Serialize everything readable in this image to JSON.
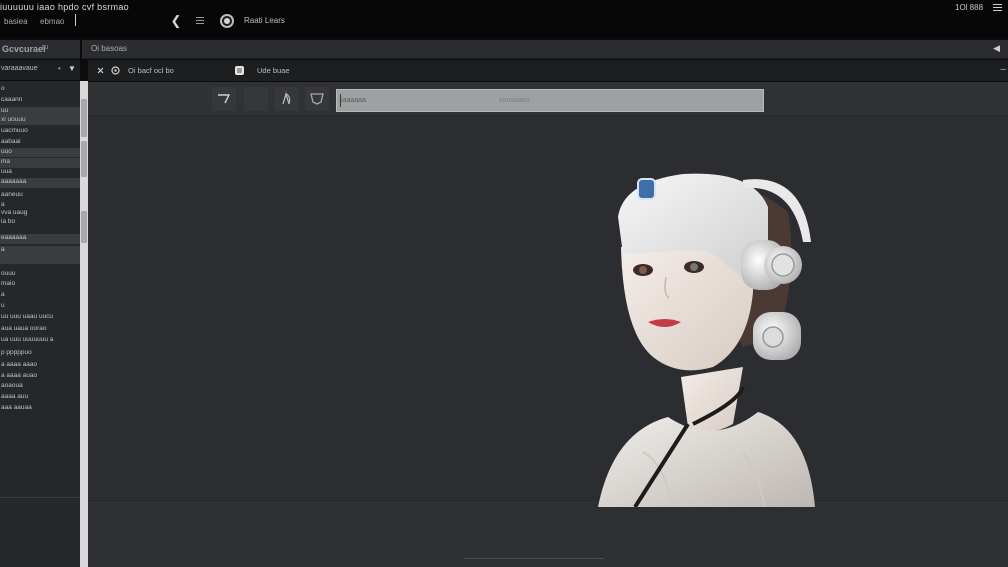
{
  "window": {
    "title": "iuuuuuu iaao hpdo cvf bsrmao",
    "subtitle": "basiea",
    "subtitle2": "ebmao",
    "session_label": "Raati Lears",
    "tray_text": "1Ol 888"
  },
  "sidebar": {
    "header": "Gcvcuraei",
    "header_extra": "ru",
    "sub_label": "varaaavaue",
    "items": [
      {
        "label": "o",
        "highlight": false
      },
      {
        "label": "caaann",
        "highlight": false
      },
      {
        "label": "uu",
        "highlight": true
      },
      {
        "label": "xi uouuu",
        "highlight": true
      },
      {
        "label": "uacmuuo",
        "highlight": false
      },
      {
        "label": "aabaai",
        "highlight": false
      },
      {
        "label": "uuo",
        "highlight": true
      },
      {
        "label": "ma",
        "highlight": true
      },
      {
        "label": "uua",
        "highlight": false
      },
      {
        "label": "aaaaaaa",
        "highlight": true
      },
      {
        "label": "aaneuu",
        "highlight": false
      },
      {
        "label": "a",
        "highlight": false
      },
      {
        "label": "vva uaug",
        "highlight": false
      },
      {
        "label": "ia bo",
        "highlight": false
      },
      {
        "label": "eaaaaaa",
        "highlight": true
      },
      {
        "label": "a",
        "highlight": true
      },
      {
        "label": "ouuu",
        "highlight": false
      },
      {
        "label": "maio",
        "highlight": false
      },
      {
        "label": "a",
        "highlight": false
      },
      {
        "label": "u",
        "highlight": false
      },
      {
        "label": "uu uuu uaau uucu",
        "highlight": false
      },
      {
        "label": "aua uaua oorao",
        "highlight": false
      },
      {
        "label": "ua uuu uuuuuuu a",
        "highlight": false
      },
      {
        "label": "p pppppuo",
        "highlight": false
      },
      {
        "label": "a aaaa aaao",
        "highlight": false
      },
      {
        "label": "a aaaa auao",
        "highlight": false
      },
      {
        "label": "aoaoua",
        "highlight": false
      },
      {
        "label": "aaaa auu",
        "highlight": false
      },
      {
        "label": "aaa aauaa",
        "highlight": false
      }
    ]
  },
  "main": {
    "tab_title": "Oi basoas",
    "toolbar_text": "Oi bacf ocl bo",
    "toolbar_text2": "Ude buae",
    "search_placeholder": "iaaaaaa",
    "search_mid": "xouaaaou"
  },
  "colors": {
    "background": "#2b2d30",
    "panel": "#25272a",
    "titlebar": "#070707"
  },
  "icons": [
    "back-icon",
    "menu-icon",
    "record-icon",
    "close-icon",
    "pin-icon",
    "gear-icon",
    "zoom-icon",
    "crop-icon",
    "moon-icon",
    "paint-icon",
    "shield-icon"
  ]
}
